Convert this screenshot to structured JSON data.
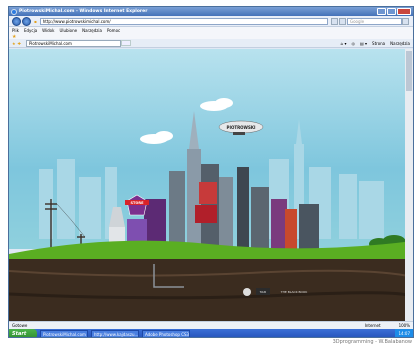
{
  "window": {
    "title": "PiotrowskiMichal.com - Windows Internet Explorer"
  },
  "address": {
    "url": "http://www.piotrowskimichal.com/",
    "search_placeholder": "Google"
  },
  "menu": [
    "Plik",
    "Edycja",
    "Widok",
    "Ulubione",
    "Narzędzia",
    "Pomoc"
  ],
  "tab": {
    "label": "PiotrowskiMichal.com"
  },
  "toolbar": {
    "page_label": "Strona",
    "tools_label": "Narzędzia"
  },
  "scene": {
    "badge": "STORE",
    "blimp": "PIOTROWSKI",
    "sign": "THE BLACK BOOK",
    "logo": "TAXI"
  },
  "status": {
    "left": "Gotowe",
    "zone": "Internet",
    "zoom": "100%"
  },
  "taskbar": {
    "start_label": "Start",
    "tasks": [
      "PiotrowskiMichal.com",
      "http://www.kajdaszu...",
      "Adobe Photoshop CS3..."
    ],
    "clock": "14:07"
  },
  "credit": "3Dprogramming - W.Balabanow",
  "colors": {
    "sky": "#8fd0dd",
    "grass": "#5aae22",
    "soil": "#3b2c1f",
    "taskbar": "#2452b8"
  }
}
